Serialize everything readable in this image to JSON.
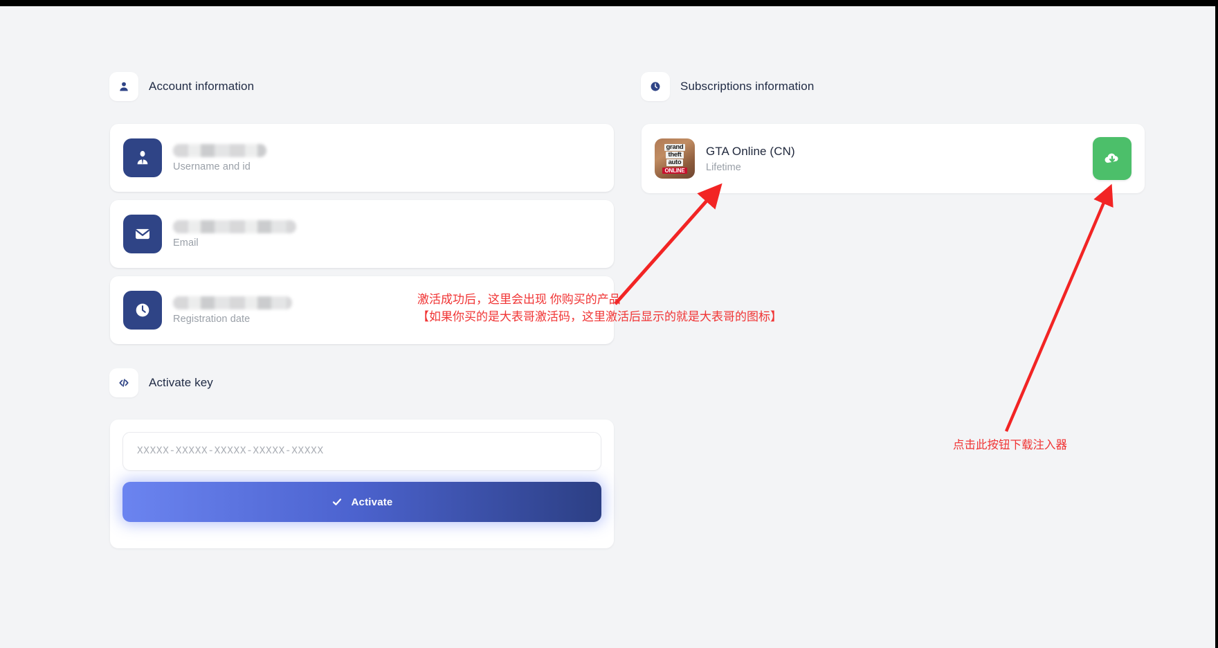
{
  "sections": {
    "account": {
      "title": "Account information",
      "icon": "user-icon"
    },
    "subscriptions": {
      "title": "Subscriptions information",
      "icon": "clock-icon"
    },
    "activate": {
      "title": "Activate key",
      "icon": "code-brackets-icon"
    }
  },
  "account_cards": [
    {
      "label": "Username and id",
      "icon": "user-badge-icon",
      "value": ""
    },
    {
      "label": "Email",
      "icon": "envelope-icon",
      "value": ""
    },
    {
      "label": "Registration date",
      "icon": "clock-icon",
      "value": ""
    }
  ],
  "activate_form": {
    "key_placeholder": "XXXXX-XXXXX-XXXXX-XXXXX-XXXXX",
    "key_value": "",
    "button_label": "Activate",
    "button_icon": "check-icon"
  },
  "subscriptions": [
    {
      "title": "GTA Online (CN)",
      "duration": "Lifetime",
      "thumb_lines": [
        "grand",
        "theft",
        "auto"
      ],
      "thumb_badge": "ONLINE",
      "download_icon": "cloud-download-icon"
    }
  ],
  "annotations": {
    "product_note_line1": "激活成功后，这里会出现 你购买的产品",
    "product_note_line2": "【如果你买的是大表哥激活码，这里激活后显示的就是大表哥的图标】",
    "download_note": "点击此按钮下载注入器"
  },
  "colors": {
    "page_background": "#f3f4f6",
    "card_background": "#ffffff",
    "icon_badge_blue": "#2f4486",
    "activate_gradient_start": "#6b84f0",
    "activate_gradient_end": "#2c3f84",
    "download_green": "#4cbf6a",
    "annotation_red": "#f03434",
    "label_gray": "#9aa0a8",
    "title_navy": "#1f2a44"
  }
}
